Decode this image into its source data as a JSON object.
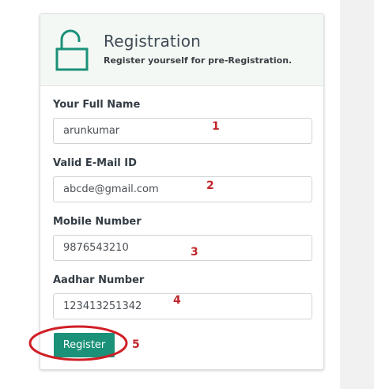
{
  "form": {
    "title": "Registration",
    "subtitle": "Register yourself for pre-Registration.",
    "fields": [
      {
        "label": "Your Full Name",
        "value": "arunkumar",
        "marker": "1"
      },
      {
        "label": "Valid E-Mail ID",
        "value": "abcde@gmail.com",
        "marker": "2"
      },
      {
        "label": "Mobile Number",
        "value": "9876543210",
        "marker": "3"
      },
      {
        "label": "Aadhar Number",
        "value": "123413251342",
        "marker": "4"
      }
    ],
    "register_label": "Register",
    "register_marker": "5"
  },
  "colors": {
    "accent": "#1a9178",
    "header_bg": "#f3f8f4",
    "annotation": "#c0262c"
  },
  "icons": {
    "header_icon": "unlock-icon"
  }
}
